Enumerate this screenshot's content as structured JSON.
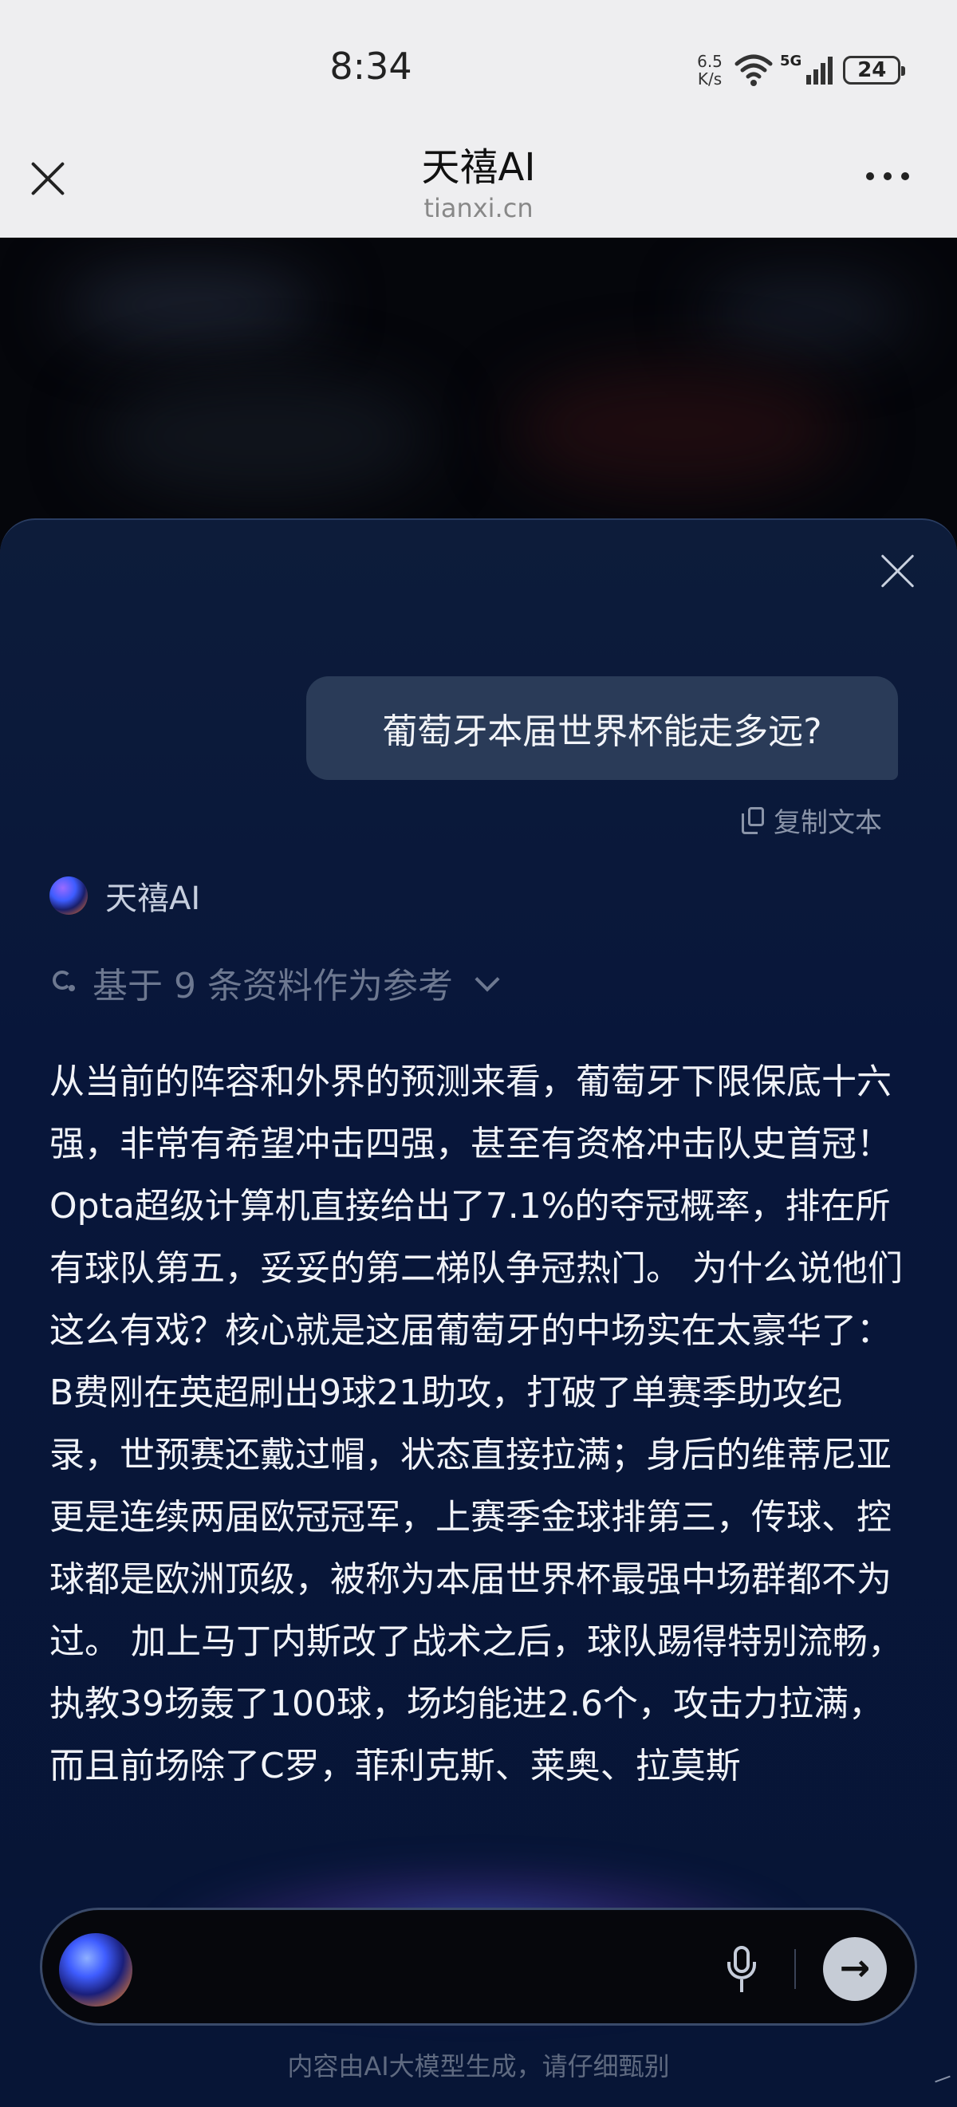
{
  "status_bar": {
    "time": "8:34",
    "net_speed_value": "6.5",
    "net_speed_unit": "K/s",
    "signal_label": "5G",
    "battery": "24"
  },
  "browser": {
    "title": "天禧AI",
    "url": "tianxi.cn"
  },
  "chat": {
    "user_message": "葡萄牙本届世界杯能走多远?",
    "copy_label": "复制文本",
    "ai_name": "天禧AI",
    "references_label": "基于 9 条资料作为参考",
    "answer": "从当前的阵容和外界的预测来看，葡萄牙下限保底十六强，非常有希望冲击四强，甚至有资格冲击队史首冠！Opta超级计算机直接给出了7.1%的夺冠概率，排在所有球队第五，妥妥的第二梯队争冠热门。 为什么说他们这么有戏？核心就是这届葡萄牙的中场实在太豪华了：B费刚在英超刷出9球21助攻，打破了单赛季助攻纪录，世预赛还戴过帽，状态直接拉满；身后的维蒂尼亚更是连续两届欧冠冠军，上赛季金球排第三，传球、控球都是欧洲顶级，被称为本届世界杯最强中场群都不为过。 加上马丁内斯改了战术之后，球队踢得特别流畅，执教39场轰了100球，场均能进2.6个，攻击力拉满，而且前场除了C罗，菲利克斯、莱奥、拉莫斯"
  },
  "input": {
    "placeholder": "",
    "disclaimer": "内容由AI大模型生成，请仔细甄别"
  },
  "icons": {
    "close": "close-icon",
    "more": "more-icon",
    "copy": "copy-icon",
    "mic": "mic-icon",
    "send": "arrow-right-icon"
  }
}
